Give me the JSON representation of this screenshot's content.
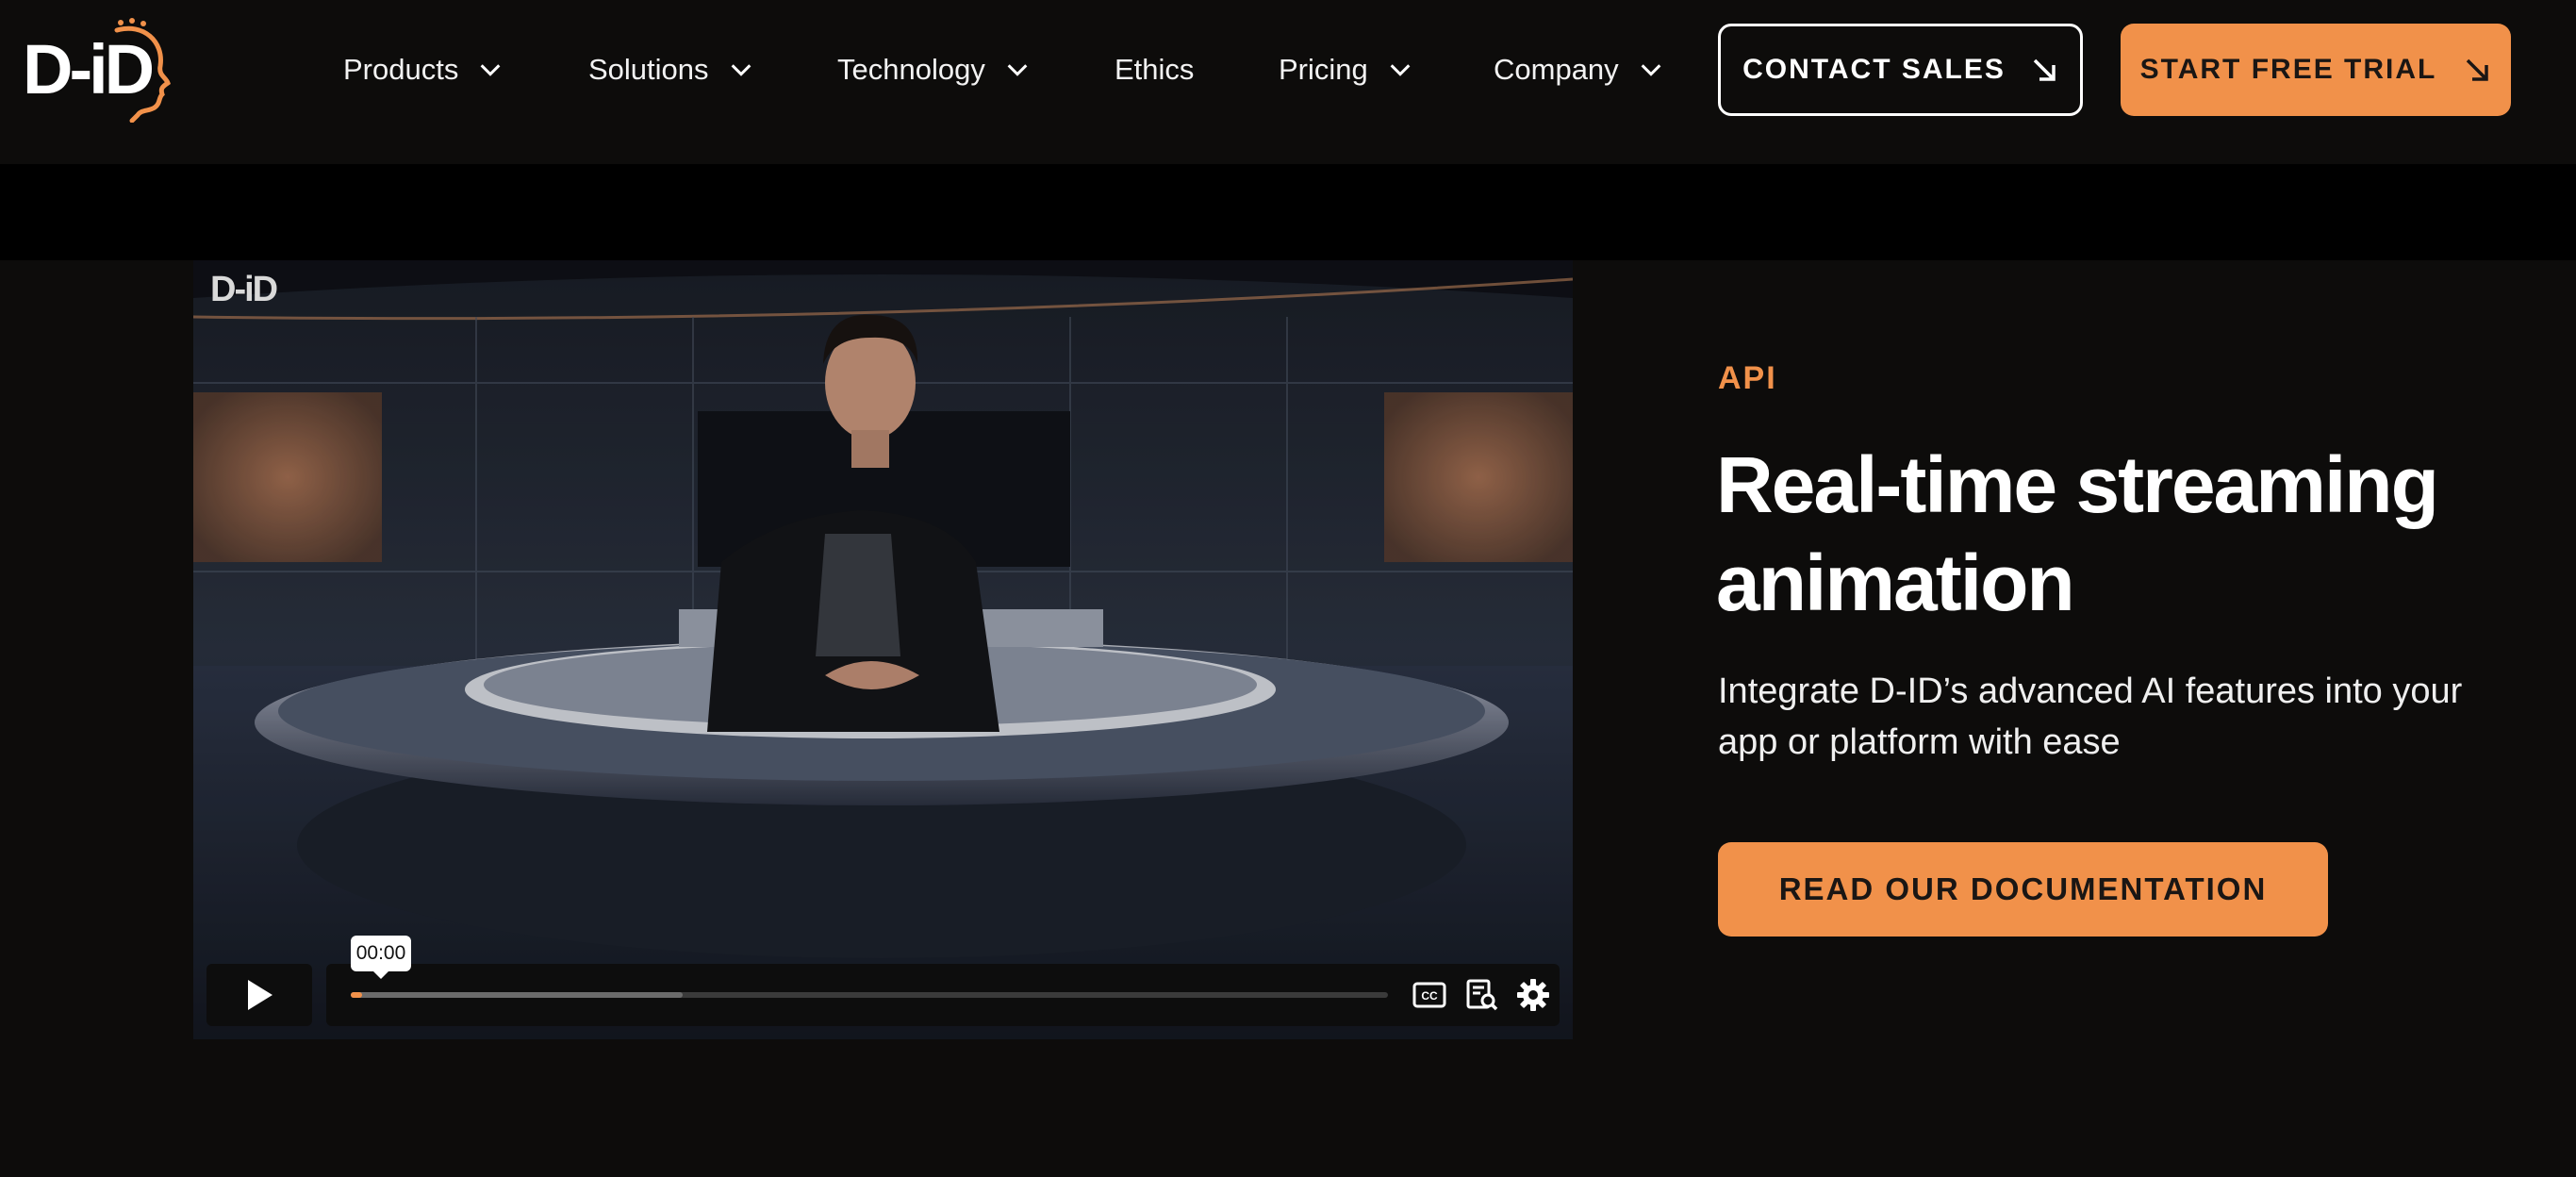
{
  "brand": {
    "logo_text": "D-iD",
    "accent": "#f1914a"
  },
  "nav": {
    "items": [
      {
        "label": "Products",
        "has_dropdown": true
      },
      {
        "label": "Solutions",
        "has_dropdown": true
      },
      {
        "label": "Technology",
        "has_dropdown": true
      },
      {
        "label": "Ethics",
        "has_dropdown": false
      },
      {
        "label": "Pricing",
        "has_dropdown": true
      },
      {
        "label": "Company",
        "has_dropdown": true
      }
    ],
    "contact_label": "CONTACT SALES",
    "trial_label": "START FREE TRIAL"
  },
  "video": {
    "watermark": "D-iD",
    "current_time": "00:00",
    "played_fraction": 0.011,
    "buffered_fraction": 0.32,
    "icons": [
      "play-icon",
      "closed-captions-icon",
      "transcript-search-icon",
      "settings-gear-icon"
    ]
  },
  "hero": {
    "eyebrow": "API",
    "title_line1": "Real-time streaming",
    "title_line2": "animation",
    "description_line1": "Integrate D-ID’s advanced AI features into your",
    "description_line2": "app or platform with ease",
    "cta_label": "READ OUR DOCUMENTATION"
  }
}
